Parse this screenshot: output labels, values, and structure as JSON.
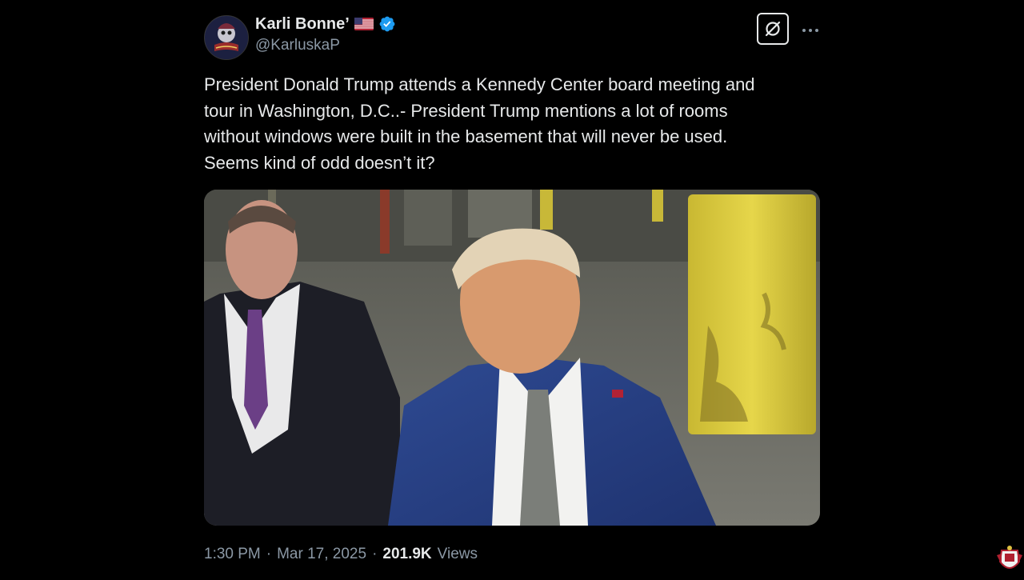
{
  "tweet": {
    "author_name": "Karli Bonne’",
    "handle": "@KarluskaP",
    "text_lines": [
      "President Donald Trump attends a Kennedy Center board meeting and",
      "tour in Washington, D.C..- President Trump mentions a lot of rooms",
      "without windows were built in the basement that will never be used.",
      "Seems kind of odd doesn’t it?"
    ],
    "time": "1:30 PM",
    "separator": "·",
    "date": "Mar 17, 2025",
    "views_count": "201.9K",
    "views_label": "Views"
  },
  "icons": {
    "avatar": "profile-avatar",
    "flag": "us-flag-emoji",
    "verified": "verified-badge-icon",
    "grok": "grok-icon",
    "more": "more-options-icon",
    "watermark": "channel-crest-logo"
  },
  "colors": {
    "background": "#000000",
    "primary_text": "#e7e9ea",
    "secondary_text": "#8b98a5",
    "verified_blue": "#1d9bf0"
  }
}
